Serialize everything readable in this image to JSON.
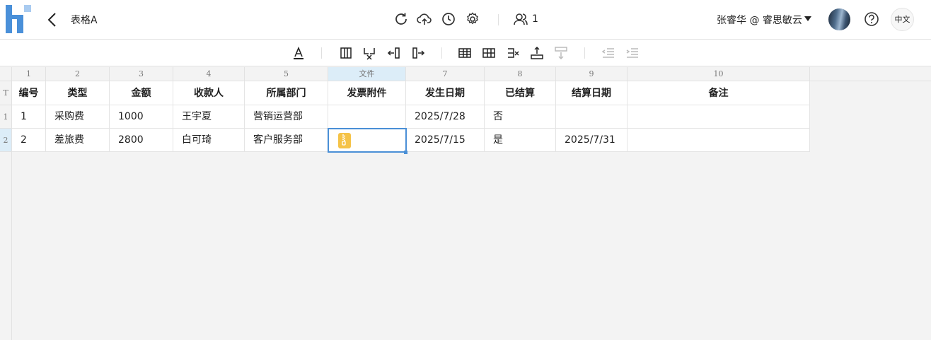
{
  "header": {
    "title": "表格A",
    "collaborators_count": "1",
    "user_label": "张睿华 @ 睿思敏云",
    "lang_label": "中文",
    "icons": [
      "app-logo",
      "back-arrow",
      "refresh-icon",
      "cloud-upload-icon",
      "history-clock-icon",
      "settings-gear-icon",
      "collaborators-icon",
      "user-dropdown-caret",
      "avatar",
      "help-icon"
    ]
  },
  "toolbar": {
    "icons": [
      "text-color-icon",
      "insert-column-icon",
      "delete-column-icon",
      "insert-column-left-icon",
      "insert-column-right-icon",
      "table-icon",
      "insert-row-icon",
      "delete-row-icon",
      "row-up-icon",
      "row-down-icon",
      "outdent-icon",
      "indent-icon"
    ]
  },
  "sheet": {
    "column_headers": [
      "1",
      "2",
      "3",
      "4",
      "5",
      "文件",
      "7",
      "8",
      "9",
      "10"
    ],
    "row_headers": [
      "T",
      "1",
      "2"
    ],
    "rows": [
      [
        "编号",
        "类型",
        "金额",
        "收款人",
        "所属部门",
        "发票附件",
        "发生日期",
        "已结算",
        "结算日期",
        "备注"
      ],
      [
        "1",
        "采购费",
        "1000",
        "王宇夏",
        "营销运营部",
        "",
        "2025/7/28",
        "否",
        "",
        ""
      ],
      [
        "2",
        "差旅费",
        "2800",
        "白可琦",
        "客户服务部",
        "",
        "2025/7/15",
        "是",
        "2025/7/31",
        ""
      ]
    ],
    "selected_cell": {
      "row": 2,
      "col": 5
    },
    "attachment_color": "#f5c348",
    "selection_color": "#4a8fd6"
  }
}
